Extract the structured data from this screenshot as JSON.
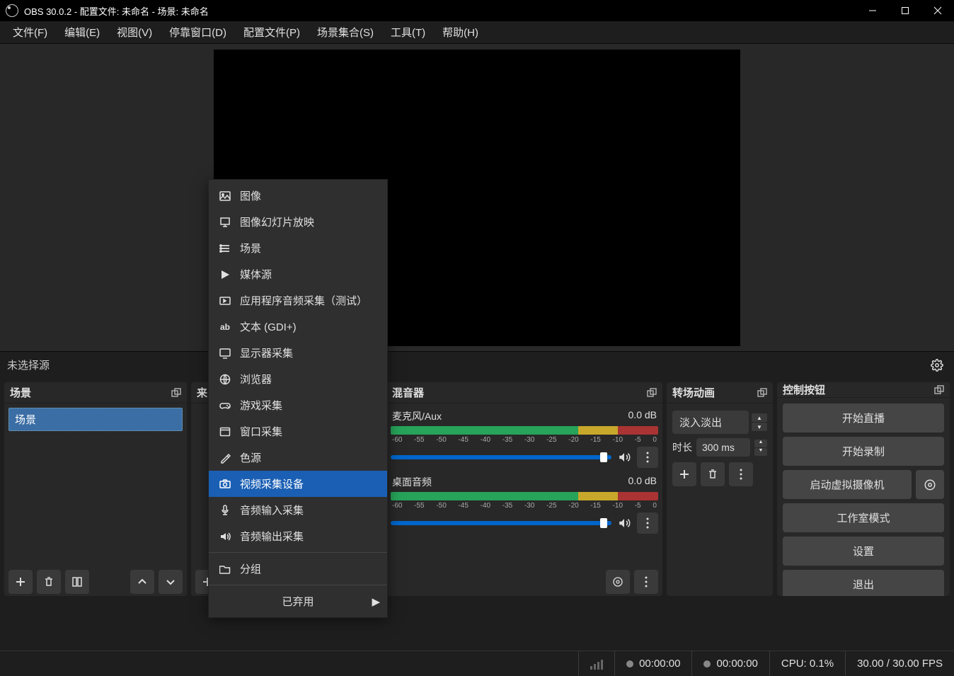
{
  "title": "OBS 30.0.2 - 配置文件: 未命名 - 场景: 未命名",
  "menubar": [
    "文件(F)",
    "编辑(E)",
    "视图(V)",
    "停靠窗口(D)",
    "配置文件(P)",
    "场景集合(S)",
    "工具(T)",
    "帮助(H)"
  ],
  "source_bar": {
    "label": "未选择源"
  },
  "docks": {
    "scenes": {
      "title": "场景",
      "items": [
        "场景"
      ]
    },
    "sources": {
      "title": "来"
    },
    "mixer": {
      "title": "混音器",
      "channels": [
        {
          "name": "麦克风/Aux",
          "level": "0.0 dB"
        },
        {
          "name": "桌面音频",
          "level": "0.0 dB"
        }
      ],
      "ticks": [
        "-60",
        "-55",
        "-50",
        "-45",
        "-40",
        "-35",
        "-30",
        "-25",
        "-20",
        "-15",
        "-10",
        "-5",
        "0"
      ]
    },
    "transitions": {
      "title": "转场动画",
      "selected": "淡入淡出",
      "dur_label": "时长",
      "dur_value": "300 ms"
    },
    "controls": {
      "title": "控制按钮",
      "buttons": {
        "stream": "开始直播",
        "record": "开始录制",
        "vcam": "启动虚拟摄像机",
        "studio": "工作室模式",
        "settings": "设置",
        "exit": "退出"
      }
    }
  },
  "context_menu": {
    "items": [
      {
        "icon": "image",
        "label": "图像"
      },
      {
        "icon": "slideshow",
        "label": "图像幻灯片放映"
      },
      {
        "icon": "scene",
        "label": "场景"
      },
      {
        "icon": "play",
        "label": "媒体源"
      },
      {
        "icon": "appaudio",
        "label": "应用程序音频采集（测试）"
      },
      {
        "icon": "text",
        "label": "文本 (GDI+)"
      },
      {
        "icon": "display",
        "label": "显示器采集"
      },
      {
        "icon": "browser",
        "label": "浏览器"
      },
      {
        "icon": "gamepad",
        "label": "游戏采集"
      },
      {
        "icon": "window",
        "label": "窗口采集"
      },
      {
        "icon": "color",
        "label": "色源"
      },
      {
        "icon": "camera",
        "label": "视频采集设备",
        "selected": true
      },
      {
        "icon": "mic",
        "label": "音频输入采集"
      },
      {
        "icon": "spk",
        "label": "音频输出采集"
      }
    ],
    "group": {
      "icon": "folder",
      "label": "分组"
    },
    "deprecated": "已弃用"
  },
  "status": {
    "live_time": "00:00:00",
    "rec_time": "00:00:00",
    "cpu": "CPU: 0.1%",
    "fps": "30.00 / 30.00 FPS"
  }
}
